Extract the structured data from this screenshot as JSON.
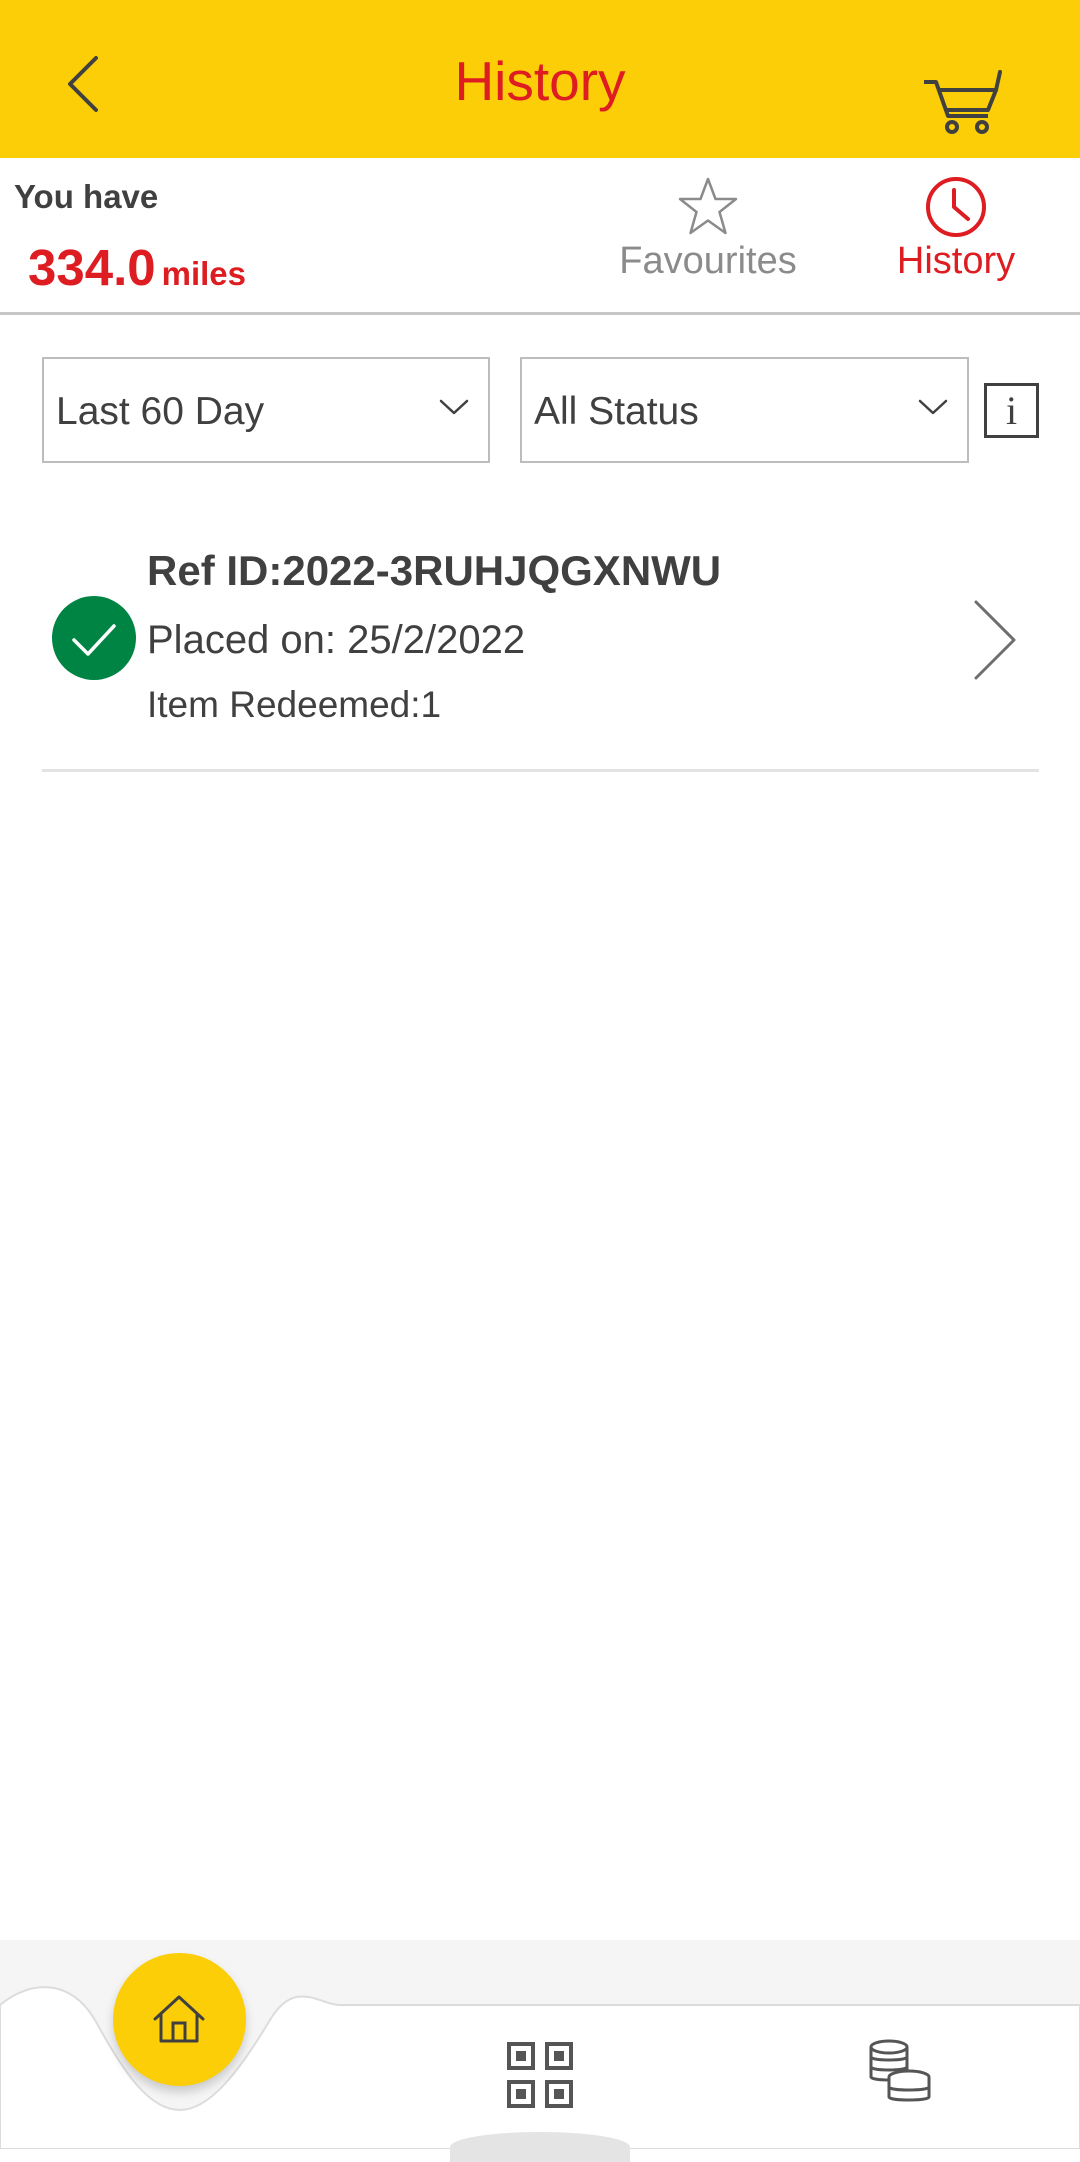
{
  "header": {
    "title": "History",
    "background_color": "#FBCE07",
    "title_color": "#DD1D21",
    "back_icon": "chevron-left-icon",
    "cart_icon": "cart-icon"
  },
  "balance": {
    "label": "You have",
    "value": "334.0",
    "unit": "miles"
  },
  "tabs": [
    {
      "label": "Favourites",
      "icon": "star-icon",
      "active": false
    },
    {
      "label": "History",
      "icon": "clock-icon",
      "active": true
    }
  ],
  "filters": {
    "date_range": {
      "selected": "Last 60 Day"
    },
    "status": {
      "selected": "All Status"
    },
    "info_icon": "info-icon"
  },
  "orders": [
    {
      "ref_id": "Ref ID:2022-3RUHJQGXNWU",
      "placed_on": "Placed on: 25/2/2022",
      "items_redeemed": "Item Redeemed:1",
      "status_icon": "check-circle-icon",
      "status_color": "#008443"
    }
  ],
  "bottom_nav": {
    "items": [
      {
        "icon": "home-icon",
        "active": true
      },
      {
        "icon": "qr-code-icon",
        "active": false
      },
      {
        "icon": "coins-icon",
        "active": false
      }
    ]
  }
}
